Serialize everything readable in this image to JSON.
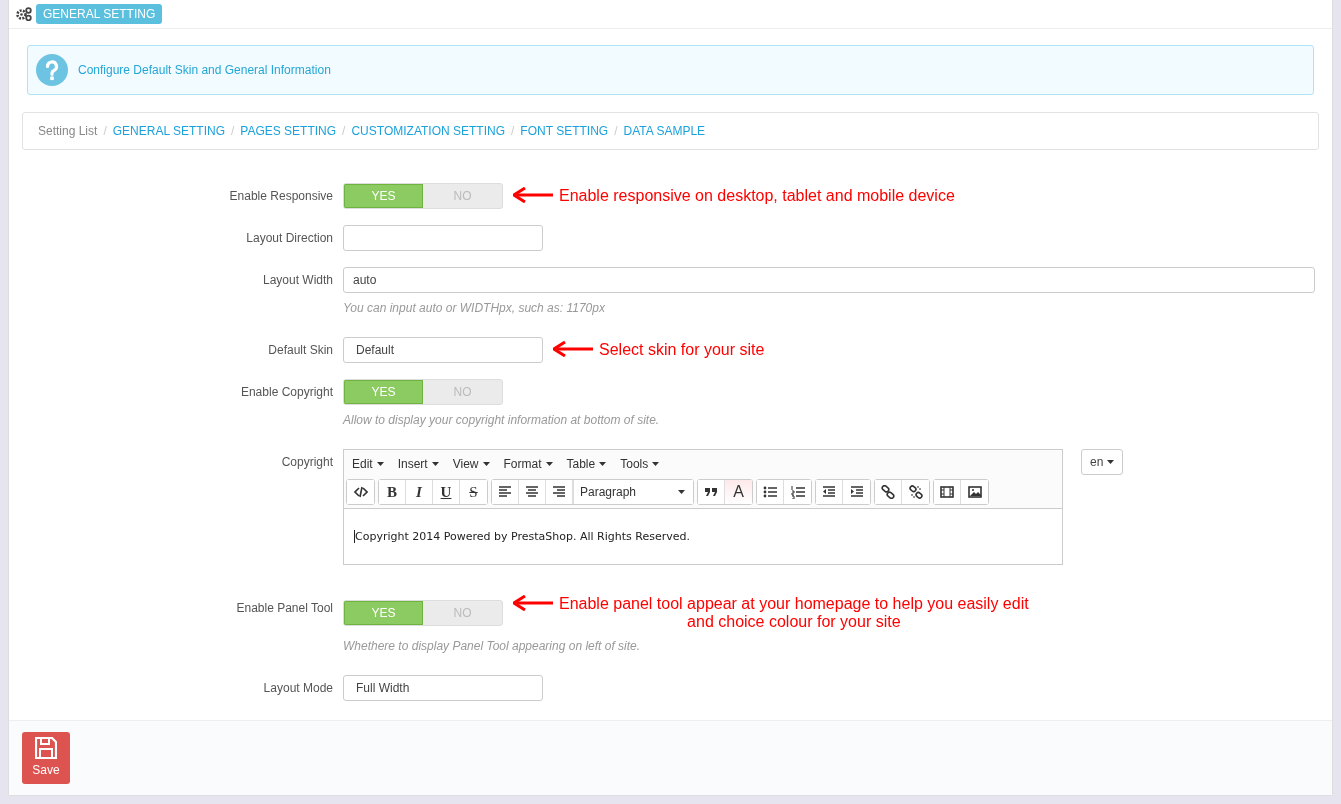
{
  "header": {
    "title": "GENERAL SETTING"
  },
  "alert": {
    "text": "Configure Default Skin and General Information"
  },
  "breadcrumb": [
    {
      "label": "Setting List",
      "link": false
    },
    {
      "separator": "/",
      "label": "GENERAL SETTING",
      "link": true
    },
    {
      "separator": "/",
      "label": "PAGES SETTING",
      "link": true
    },
    {
      "separator": "/",
      "label": "CUSTOMIZATION SETTING",
      "link": true
    },
    {
      "separator": "/",
      "label": "FONT SETTING",
      "link": true
    },
    {
      "separator": "/",
      "label": "DATA SAMPLE",
      "link": true
    }
  ],
  "fields": [
    {
      "kind": "switch",
      "label": "Enable Responsive",
      "on": true,
      "yes": "YES",
      "no": "NO",
      "annotation": [
        "Enable responsive on desktop, tablet and mobile device"
      ]
    },
    {
      "kind": "input",
      "label": "Layout Direction"
    },
    {
      "kind": "wide-input",
      "label": "Layout Width",
      "value": "auto",
      "help": "You can input auto or WIDTHpx, such as: 1170px"
    },
    {
      "kind": "select",
      "label": "Default Skin",
      "value": "Default",
      "annotation": [
        "Select skin for your site"
      ]
    },
    {
      "kind": "switch",
      "label": "Enable Copyright",
      "on": true,
      "yes": "YES",
      "no": "NO",
      "help": "Allow to display your copyright information at bottom of site."
    },
    {
      "kind": "editor",
      "label": "Copyright",
      "menus": [
        "Edit",
        "Insert",
        "View",
        "Format",
        "Table",
        "Tools"
      ],
      "letters": [
        "B",
        "I",
        "U",
        "S"
      ],
      "block_format": "Paragraph",
      "color_letter": "A",
      "content": "Copyright 2014 Powered by PrestaShop. All Rights Reserved.",
      "language": "en"
    },
    {
      "kind": "switch",
      "label": "Enable Panel Tool",
      "on": true,
      "yes": "YES",
      "no": "NO",
      "help": "Whethere to display Panel Tool appearing on left of site.",
      "annotation": [
        "Enable panel tool appear at your homepage to help you easily edit",
        "and choice colour for your site"
      ]
    },
    {
      "kind": "select",
      "label": "Layout Mode",
      "value": "Full Width"
    }
  ],
  "footer": {
    "save": "Save"
  }
}
